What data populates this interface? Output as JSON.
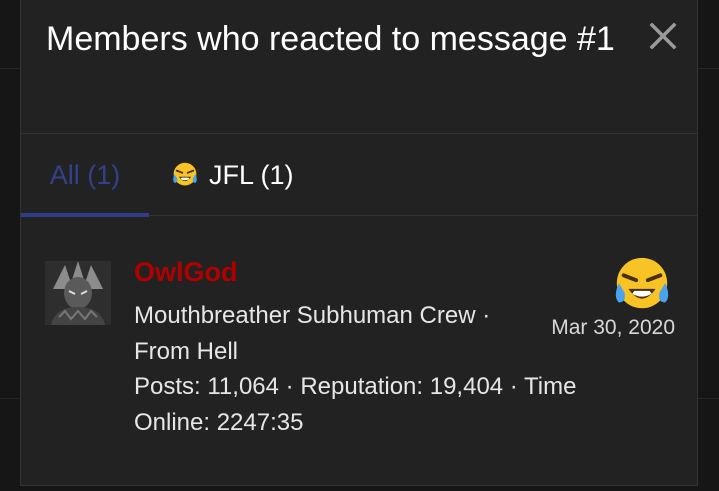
{
  "modal": {
    "title": "Members who reacted to message #1",
    "close_icon": "close-icon"
  },
  "tabs": [
    {
      "label": "All (1)",
      "active": true
    },
    {
      "label": "JFL (1)",
      "icon": "crying-laughing-emoji-icon",
      "active": false
    }
  ],
  "member": {
    "username": "OwlGod",
    "title_line": "Mouthbreather Subhuman Crew · From Hell",
    "stats_line": "Posts: 11,064 · Reputation: 19,404 · Time Online: 2247:35",
    "reaction_icon": "crying-laughing-emoji-icon",
    "reaction_date": "Mar 30, 2020"
  },
  "colors": {
    "modal_bg": "#222222",
    "active_tab": "#2f3e86",
    "username": "#b20000",
    "emoji_yellow": "#f7c325",
    "emoji_tears": "#4aa3ef"
  }
}
